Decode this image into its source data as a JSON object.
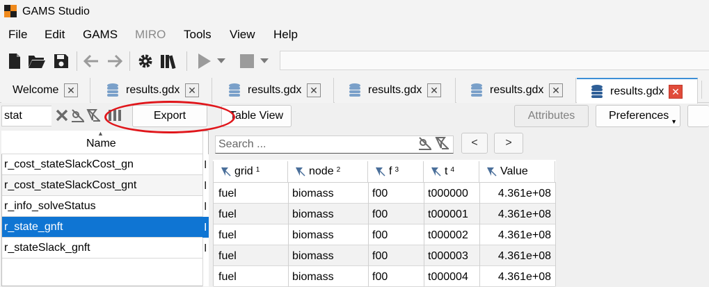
{
  "app": {
    "title": "GAMS Studio"
  },
  "menu": [
    "File",
    "Edit",
    "GAMS",
    "MIRO",
    "Tools",
    "View",
    "Help"
  ],
  "toolbar": {
    "icons": [
      "new-file-icon",
      "open-folder-icon",
      "save-icon",
      "back-arrow-icon",
      "forward-arrow-icon",
      "settings-gear-icon",
      "library-icon",
      "run-play-icon",
      "run-dropdown-icon",
      "stop-icon",
      "stop-dropdown-icon"
    ],
    "command_line": ""
  },
  "tabs": [
    {
      "label": "Welcome",
      "active": false
    },
    {
      "label": "results.gdx",
      "active": false
    },
    {
      "label": "results.gdx",
      "active": false
    },
    {
      "label": "results.gdx",
      "active": false
    },
    {
      "label": "results.gdx",
      "active": false
    },
    {
      "label": "results.gdx",
      "active": true
    }
  ],
  "symbols": {
    "filter_value": "stat",
    "column_header": "Name",
    "rows": [
      {
        "name": "r_cost_stateSlackCost_gn",
        "col2": "I",
        "selected": false
      },
      {
        "name": "r_cost_stateSlackCost_gnt",
        "col2": "I",
        "selected": false
      },
      {
        "name": "r_info_solveStatus",
        "col2": "I",
        "selected": false
      },
      {
        "name": "r_state_gnft",
        "col2": "I",
        "selected": true
      },
      {
        "name": "r_stateSlack_gnft",
        "col2": "I",
        "selected": false
      }
    ]
  },
  "buttons": {
    "export": "Export",
    "table_view": "Table View",
    "attributes": "Attributes",
    "preferences": "Preferences",
    "prev": "<",
    "next": ">"
  },
  "search": {
    "placeholder": "Search ..."
  },
  "table": {
    "headers": [
      {
        "label": "grid",
        "order": "1"
      },
      {
        "label": "node",
        "order": "2"
      },
      {
        "label": "f",
        "order": "3"
      },
      {
        "label": "t",
        "order": "4"
      },
      {
        "label": "Value",
        "order": ""
      }
    ],
    "rows": [
      [
        "fuel",
        "biomass",
        "f00",
        "t000000",
        "4.361e+08"
      ],
      [
        "fuel",
        "biomass",
        "f00",
        "t000001",
        "4.361e+08"
      ],
      [
        "fuel",
        "biomass",
        "f00",
        "t000002",
        "4.361e+08"
      ],
      [
        "fuel",
        "biomass",
        "f00",
        "t000003",
        "4.361e+08"
      ],
      [
        "fuel",
        "biomass",
        "f00",
        "t000004",
        "4.361e+08"
      ]
    ]
  },
  "colors": {
    "accent": "#0f75d3",
    "highlight_ring": "#e0161b",
    "close_active": "#e04b3a"
  }
}
